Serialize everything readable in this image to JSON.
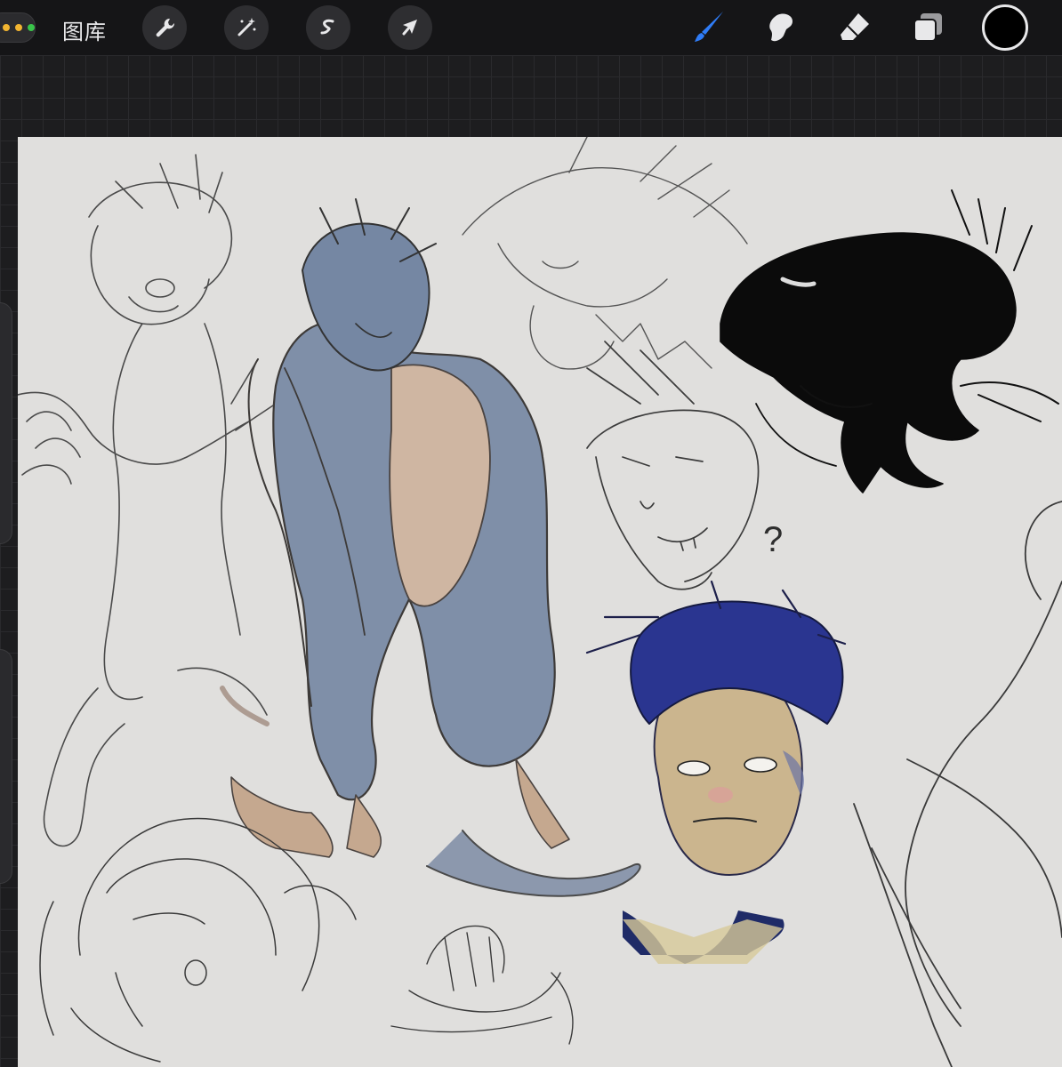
{
  "toolbar": {
    "gallery_label": "图库",
    "left_tools": [
      "wrench-icon",
      "magic-wand-icon",
      "selection-s-icon",
      "move-arrow-icon"
    ],
    "right_tools": [
      "brush-icon",
      "smudge-icon",
      "eraser-icon",
      "layers-icon"
    ],
    "active_tool": "brush",
    "current_color": "#000000",
    "accent_color": "#2f7cf6"
  },
  "canvas": {
    "background_color": "#e0dfdd",
    "question_mark": "?"
  }
}
